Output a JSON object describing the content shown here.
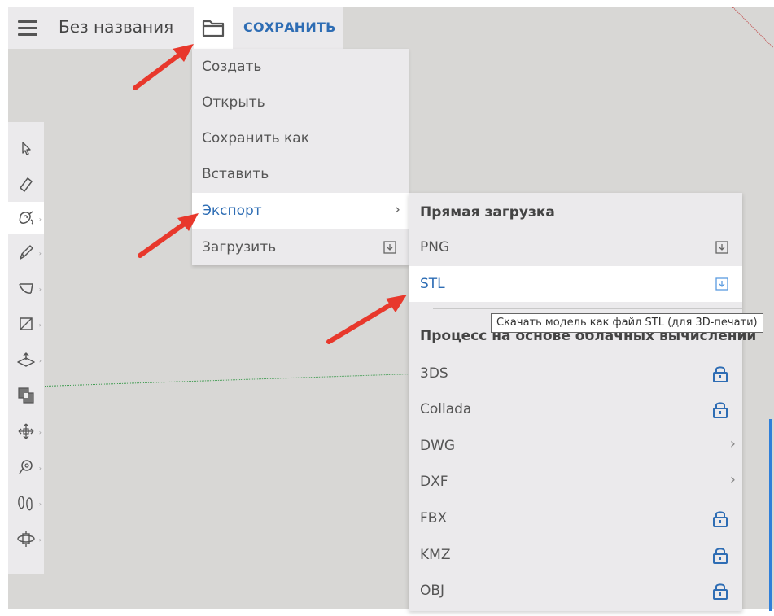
{
  "topbar": {
    "menu_icon": "hamburger-menu-icon",
    "document_title": "Без названия",
    "folder_icon": "folder-icon",
    "save_label": "СОХРАНИТЬ"
  },
  "toolbar": {
    "tools": [
      {
        "icon": "select-arrow-icon"
      },
      {
        "icon": "eraser-icon"
      },
      {
        "icon": "paint-bucket-icon",
        "active": true
      },
      {
        "icon": "pencil-icon"
      },
      {
        "icon": "arc-icon"
      },
      {
        "icon": "rectangle-icon"
      },
      {
        "icon": "push-pull-icon"
      },
      {
        "icon": "offset-icon"
      },
      {
        "icon": "move-icon"
      },
      {
        "icon": "tape-measure-icon"
      },
      {
        "icon": "walk-icon"
      },
      {
        "icon": "orbit-icon"
      }
    ]
  },
  "file_menu": {
    "items": [
      {
        "label": "Создать"
      },
      {
        "label": "Открыть"
      },
      {
        "label": "Сохранить как"
      },
      {
        "label": "Вставить"
      },
      {
        "label": "Экспорт",
        "has_submenu": true,
        "chevron": "›"
      },
      {
        "label": "Загрузить",
        "icon": "download-icon"
      }
    ]
  },
  "export_submenu": {
    "direct_header": "Прямая загрузка",
    "direct_items": [
      {
        "label": "PNG",
        "icon": "download-icon"
      },
      {
        "label": "STL",
        "icon": "download-icon"
      }
    ],
    "cloud_header": "Процесс на основе облачных вычислений",
    "cloud_items": [
      {
        "label": "3DS",
        "icon": "lock-icon"
      },
      {
        "label": "Collada",
        "icon": "lock-icon"
      },
      {
        "label": "DWG",
        "chevron": "›"
      },
      {
        "label": "DXF",
        "chevron": "›"
      },
      {
        "label": "FBX",
        "icon": "lock-icon"
      },
      {
        "label": "KMZ",
        "icon": "lock-icon"
      },
      {
        "label": "OBJ",
        "icon": "lock-icon"
      }
    ]
  },
  "tooltip": {
    "text": "Скачать модель как файл STL (для 3D-печати)"
  },
  "colors": {
    "accent": "#2e6db4",
    "arrow": "#e8382c",
    "menu_bg": "#ebeaec",
    "canvas_bg": "#d8d7d5"
  }
}
